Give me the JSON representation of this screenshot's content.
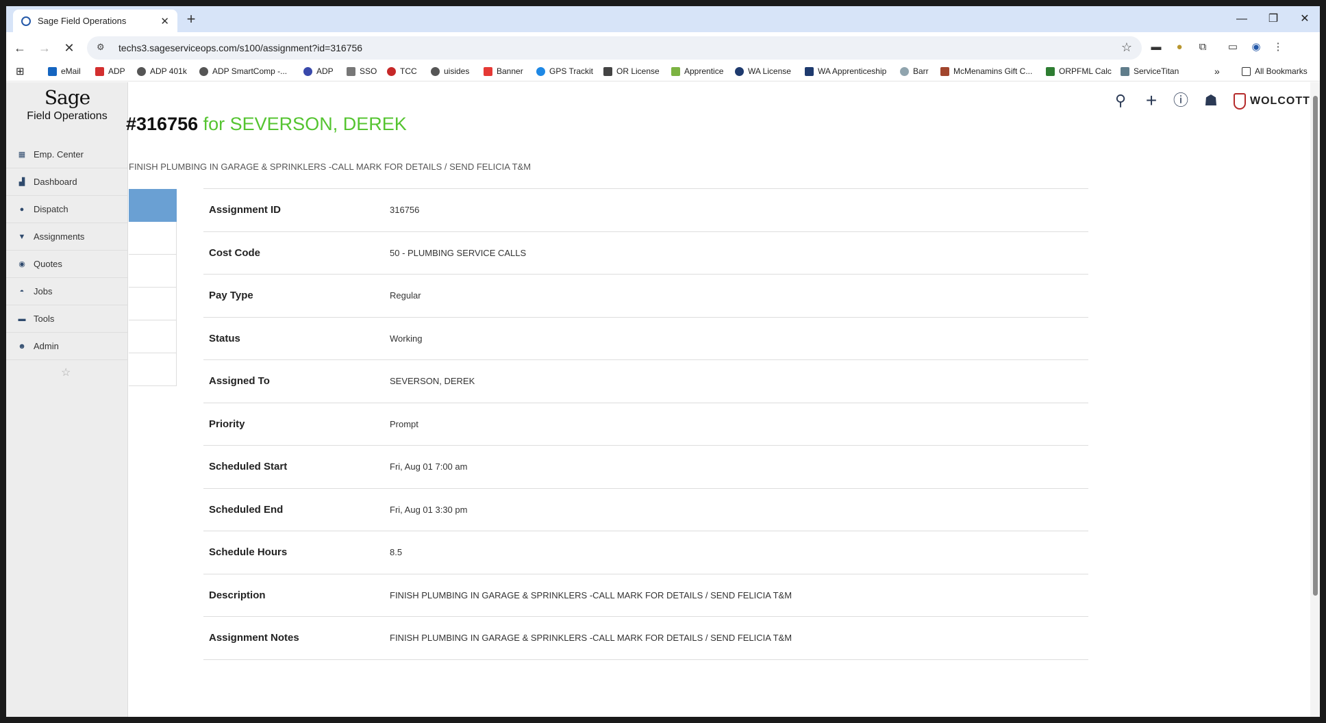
{
  "browser": {
    "tab_title": "Sage Field Operations",
    "url": "techs3.sageserviceops.com/s100/assignment?id=316756",
    "bookmarks": [
      "eMail",
      "ADP",
      "ADP 401k",
      "ADP SmartComp -...",
      "ADP",
      "SSO",
      "TCC",
      "uisides",
      "Banner",
      "GPS Trackit",
      "OR License",
      "Apprentice",
      "WA License",
      "WA Apprenticeship",
      "Barr",
      "McMenamins Gift C...",
      "ORPFML Calc",
      "ServiceTitan"
    ],
    "all_bookmarks_label": "All Bookmarks",
    "accent": "#d7e4f8"
  },
  "sidebar": {
    "logo_text": "Sage",
    "product_name": "Field Operations",
    "items": [
      {
        "label": "Emp. Center",
        "icon": "building-icon"
      },
      {
        "label": "Dashboard",
        "icon": "chart-icon"
      },
      {
        "label": "Dispatch",
        "icon": "map-pin-icon"
      },
      {
        "label": "Assignments",
        "icon": "thumbtack-icon"
      },
      {
        "label": "Quotes",
        "icon": "comment-dollar-icon"
      },
      {
        "label": "Jobs",
        "icon": "hard-hat-icon"
      },
      {
        "label": "Tools",
        "icon": "toolbox-icon"
      },
      {
        "label": "Admin",
        "icon": "users-cog-icon"
      }
    ]
  },
  "header": {
    "assignment_number": "#316756",
    "for_text": "for SEVERSON, DEREK",
    "subtitle": "FINISH PLUMBING IN GARAGE & SPRINKLERS -CALL MARK FOR DETAILS / SEND FELICIA T&M",
    "brand": "WOLCOTT",
    "title_color": "#55c431",
    "active_tab_color": "#6aa0d3"
  },
  "details": [
    {
      "label": "Assignment ID",
      "value": "316756"
    },
    {
      "label": "Cost Code",
      "value": "50 - PLUMBING SERVICE CALLS"
    },
    {
      "label": "Pay Type",
      "value": "Regular"
    },
    {
      "label": "Status",
      "value": "Working"
    },
    {
      "label": "Assigned To",
      "value": "SEVERSON, DEREK"
    },
    {
      "label": "Priority",
      "value": "Prompt"
    },
    {
      "label": "Scheduled Start",
      "value": "Fri, Aug 01 7:00 am"
    },
    {
      "label": "Scheduled End",
      "value": "Fri, Aug 01 3:30 pm"
    },
    {
      "label": "Schedule Hours",
      "value": "8.5"
    },
    {
      "label": "Description",
      "value": "FINISH PLUMBING IN GARAGE & SPRINKLERS -CALL MARK FOR DETAILS / SEND FELICIA T&M"
    },
    {
      "label": "Assignment Notes",
      "value": "FINISH PLUMBING IN GARAGE & SPRINKLERS -CALL MARK FOR DETAILS / SEND FELICIA T&M"
    }
  ]
}
